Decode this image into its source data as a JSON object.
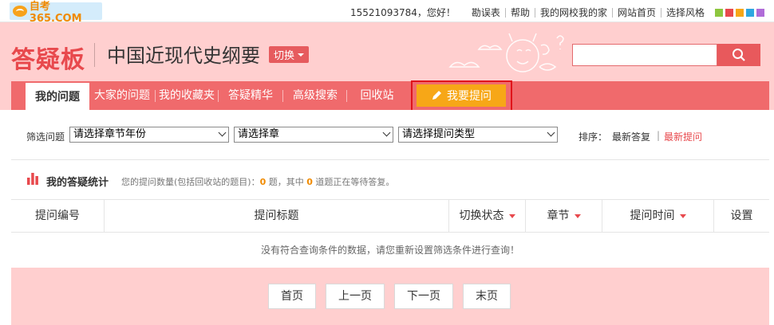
{
  "topbar": {
    "logo_text": "自考365.COM",
    "user": "15521093784，您好！",
    "links": [
      "勘误表",
      "帮助",
      "我的网校我的家",
      "网站首页",
      "选择风格"
    ],
    "swatch_colors": [
      "#8dc63f",
      "#e8494d",
      "#f7a717",
      "#2fa7e0",
      "#b06cd8"
    ]
  },
  "header": {
    "brand": "答疑板",
    "course": "中国近现代史纲要",
    "switch_label": "切换",
    "search_placeholder": ""
  },
  "tabs": [
    "我的问题",
    "大家的问题",
    "我的收藏夹",
    "答疑精华",
    "高级搜索",
    "回收站"
  ],
  "ask_button": "我要提问",
  "filter": {
    "label": "筛选问题",
    "select_year": "请选择章节年份",
    "select_chapter": "请选择章",
    "select_type": "请选择提问类型",
    "sort_label": "排序：",
    "sort_latest_reply": "最新答复",
    "sort_latest_question": "最新提问",
    "sort_sep": "|"
  },
  "stats": {
    "title": "我的答疑统计",
    "text_prefix": "您的提问数量(包括回收站的题目)：",
    "count_total": "0",
    "text_mid": " 题，其中 ",
    "count_waiting": "0",
    "text_suffix": " 道题正在等待答复。"
  },
  "table": {
    "headers": [
      "提问编号",
      "提问标题",
      "切换状态",
      "章节",
      "提问时间",
      "设置"
    ],
    "empty_message": "没有符合查询条件的数据，请您重新设置筛选条件进行查询！"
  },
  "pager": [
    "首页",
    "上一页",
    "下一页",
    "末页"
  ]
}
